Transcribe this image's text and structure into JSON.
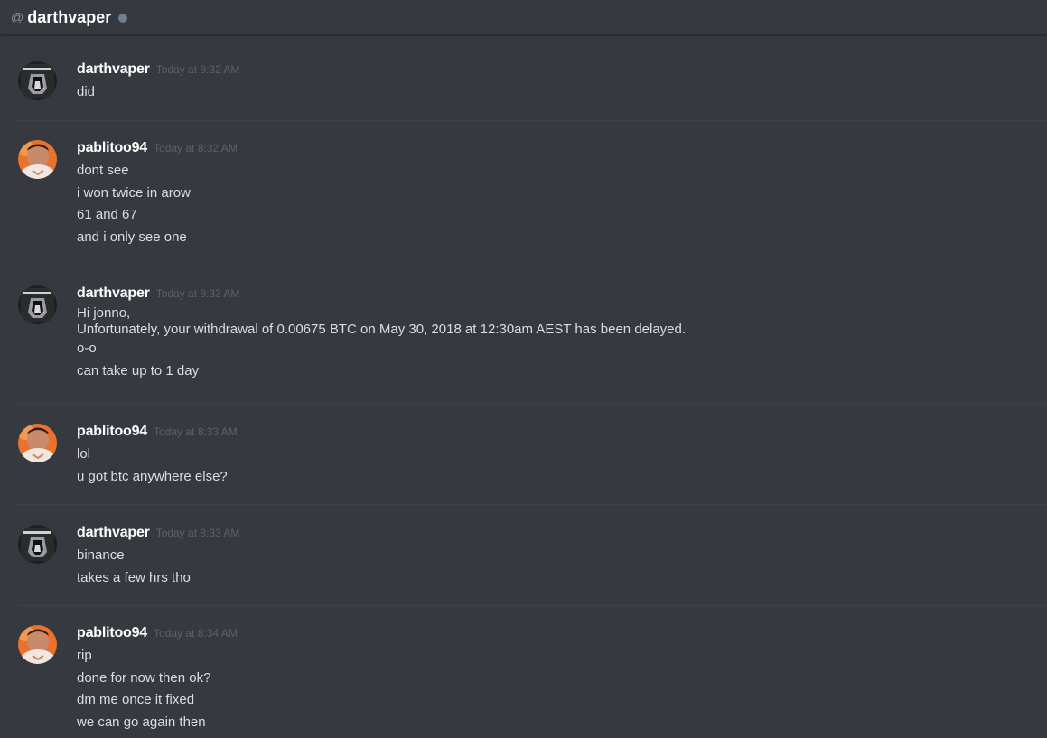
{
  "header": {
    "at_symbol": "@",
    "channel_name": "darthvaper",
    "status_color": "#747f8d"
  },
  "colors": {
    "background": "#36393f",
    "username": "#ffffff",
    "message_text": "#dcddde",
    "timestamp": "#5e6167"
  },
  "avatars": {
    "darthvaper": "dark-vader-avatar",
    "pablitoo94": "orange-photo-avatar"
  },
  "groups": [
    {
      "author": "darthvaper",
      "timestamp": "Today at 8:32 AM",
      "lines": [
        "did"
      ]
    },
    {
      "author": "pablitoo94",
      "timestamp": "Today at 8:32 AM",
      "lines": [
        "dont see",
        "i won twice in arow",
        "61 and 67",
        "and i only see one"
      ]
    },
    {
      "author": "darthvaper",
      "timestamp": "Today at 8:33 AM",
      "lines": [
        "Hi jonno,",
        "Unfortunately, your withdrawal of 0.00675 BTC on May 30, 2018 at 12:30am AEST has been delayed.",
        "o-o",
        "can take up to 1 day"
      ]
    },
    {
      "author": "pablitoo94",
      "timestamp": "Today at 8:33 AM",
      "lines": [
        "lol",
        "u got btc anywhere else?"
      ]
    },
    {
      "author": "darthvaper",
      "timestamp": "Today at 8:33 AM",
      "lines": [
        "binance",
        "takes a few hrs tho"
      ]
    },
    {
      "author": "pablitoo94",
      "timestamp": "Today at 8:34 AM",
      "lines": [
        "rip",
        "done for now then ok?",
        "dm me once it fixed",
        "we can go again then"
      ]
    }
  ]
}
